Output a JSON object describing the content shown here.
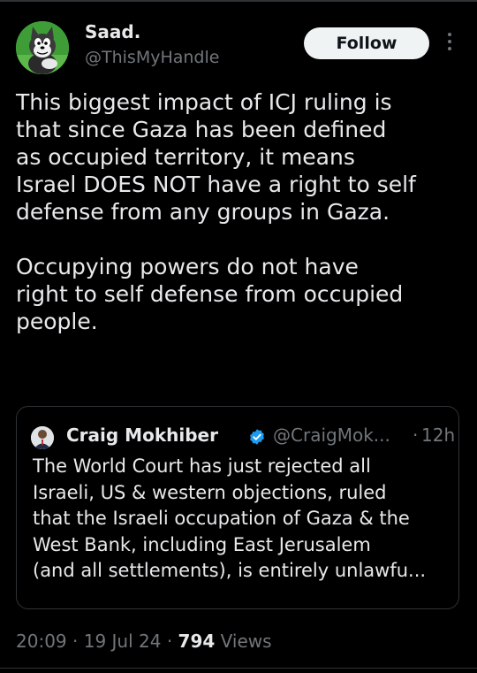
{
  "tweet": {
    "author_name": "Saad.",
    "author_handle": "@ThisMyHandle",
    "follow_label": "Follow",
    "text": "This biggest impact of ICJ ruling is\nthat since Gaza has been defined\nas occupied territory, it means\nIsrael DOES NOT have a right to self\ndefense from any groups in Gaza.\n\nOccupying powers do not have\nright to self defense from occupied\npeople.",
    "time": "20:09",
    "date": "19 Jul 24",
    "views_count": "794",
    "views_label": "Views"
  },
  "quote": {
    "author_name": "Craig Mokhiber",
    "author_handle": "@CraigMok...",
    "separator": "·",
    "time": "12h",
    "text": "The World Court has just rejected all\nIsraeli, US & western objections, ruled\nthat the Israeli occupation of Gaza & the\nWest Bank, including East Jerusalem\n(and all settlements), is entirely unlawfu..."
  },
  "icons": {
    "more": "more-vertical-icon",
    "verified": "verified-badge-icon"
  },
  "colors": {
    "background": "#000000",
    "text": "#e7e9ea",
    "secondary_text": "#71767b",
    "verified_blue": "#1d9bf0",
    "border": "#2f3336"
  }
}
